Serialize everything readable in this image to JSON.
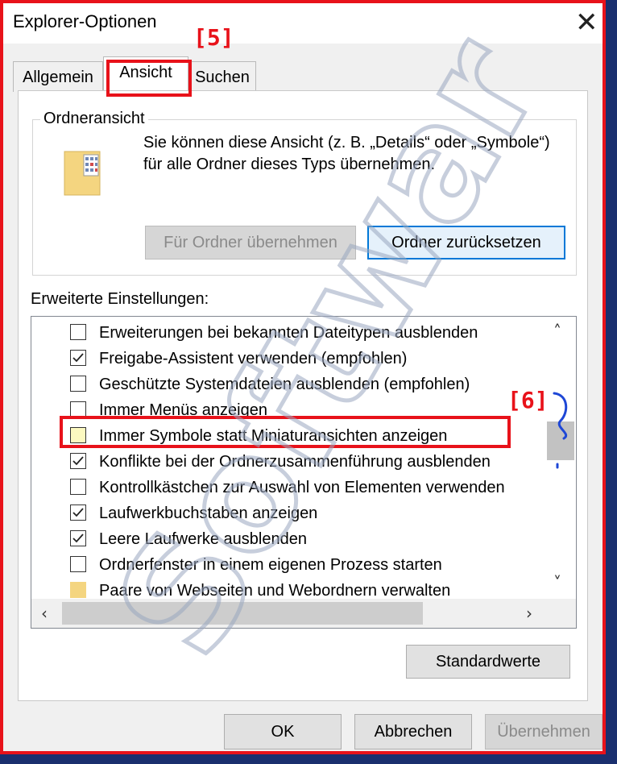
{
  "window": {
    "title": "Explorer-Optionen",
    "close_glyph": "✕"
  },
  "tabs": [
    {
      "label": "Allgemein"
    },
    {
      "label": "Ansicht"
    },
    {
      "label": "Suchen"
    }
  ],
  "folder_view": {
    "group_label": "Ordneransicht",
    "description": "Sie können diese Ansicht (z. B. „Details“ oder „Symbole“) für alle Ordner dieses Typs übernehmen.",
    "apply_button": "Für Ordner übernehmen",
    "reset_button": "Ordner zurücksetzen"
  },
  "advanced": {
    "label": "Erweiterte Einstellungen:",
    "items": [
      {
        "label": "Erweiterungen bei bekannten Dateitypen ausblenden",
        "checked": false
      },
      {
        "label": "Freigabe-Assistent verwenden (empfohlen)",
        "checked": true
      },
      {
        "label": "Geschützte Systemdateien ausblenden (empfohlen)",
        "checked": false
      },
      {
        "label": "Immer Menüs anzeigen",
        "checked": false
      },
      {
        "label": "Immer Symbole statt Miniaturansichten anzeigen",
        "checked": false
      },
      {
        "label": "Konflikte bei der Ordnerzusammenführung ausblenden",
        "checked": true
      },
      {
        "label": "Kontrollkästchen zur Auswahl von Elementen verwenden",
        "checked": false
      },
      {
        "label": "Laufwerkbuchstaben anzeigen",
        "checked": true
      },
      {
        "label": "Leere Laufwerke ausblenden",
        "checked": true
      },
      {
        "label": "Ordnerfenster in einem eigenen Prozess starten",
        "checked": false
      },
      {
        "label": "Paare von Webseiten und Webordnern verwalten",
        "checked": false
      }
    ]
  },
  "buttons": {
    "defaults": "Standardwerte",
    "ok": "OK",
    "cancel": "Abbrechen",
    "apply": "Übernehmen"
  },
  "annotations": {
    "step5": "[5]",
    "step6": "[6]"
  },
  "watermark": {
    "text": "Softwar",
    "color": "#9aa7c0"
  },
  "colors": {
    "annotation": "#e8121a",
    "accent": "#0078d7",
    "highlight": "#f7f35a"
  }
}
